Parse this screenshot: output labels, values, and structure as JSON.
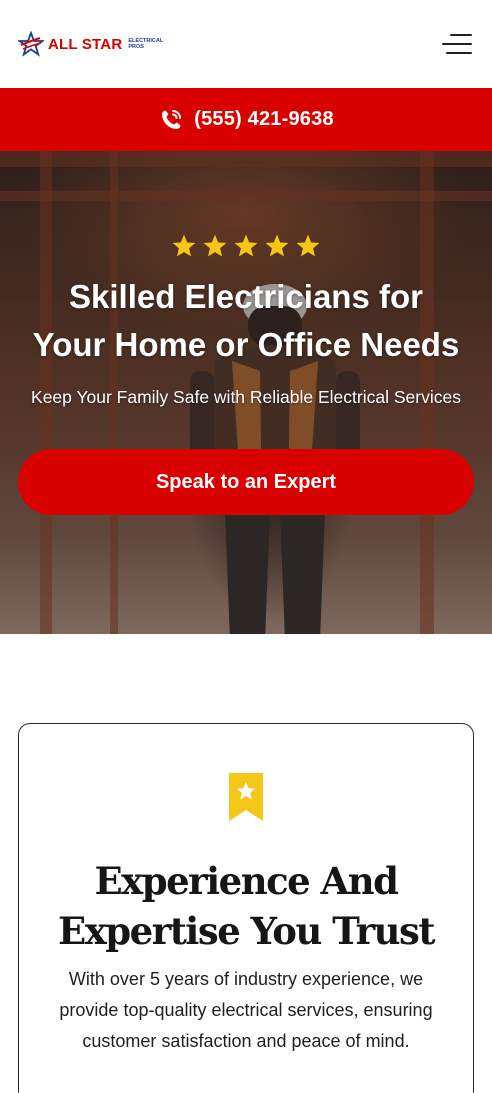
{
  "brand": {
    "name": "ALL STAR",
    "sub_line1": "ELECTRICAL",
    "sub_line2": "PROS",
    "primary_color": "#d90000",
    "secondary_color": "#1d3f8f"
  },
  "header": {
    "menu_icon": "hamburger-menu-icon"
  },
  "phone_bar": {
    "icon": "phone-ringing-icon",
    "number": "(555) 421-9638"
  },
  "hero": {
    "rating_stars": 5,
    "star_color": "#f5c518",
    "title_line1": "Skilled Electricians for",
    "title_line2": "Your Home or Office Needs",
    "subtitle": "Keep Your Family Safe with Reliable Electrical Services",
    "cta_label": "Speak to an Expert"
  },
  "feature_card": {
    "icon": "bookmark-star-icon",
    "icon_color": "#f5c518",
    "title_line1": "Experience And",
    "title_line2": "Expertise You Trust",
    "text_line1": "With over 5 years of industry experience, we",
    "text_line2": "provide top-quality electrical services, ensuring",
    "text_line3": "customer satisfaction and peace of mind."
  }
}
